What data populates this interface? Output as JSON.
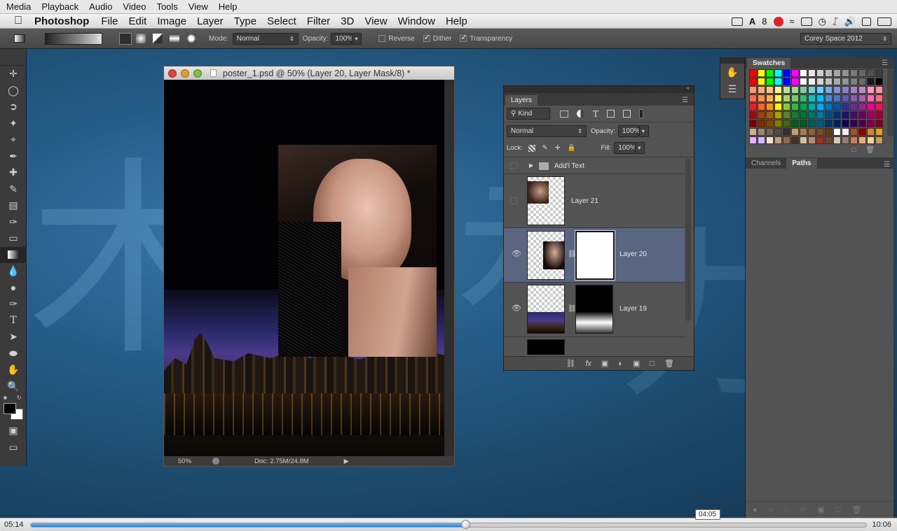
{
  "player_menu": {
    "items": [
      "Media",
      "Playback",
      "Audio",
      "Video",
      "Tools",
      "View",
      "Help"
    ]
  },
  "mac_menu": {
    "app_name": "Photoshop",
    "items": [
      "File",
      "Edit",
      "Image",
      "Layer",
      "Type",
      "Select",
      "Filter",
      "3D",
      "View",
      "Window",
      "Help"
    ],
    "tray_badge": "8",
    "clock": ""
  },
  "options_bar": {
    "mode_label": "Mode:",
    "mode_value": "Normal",
    "opacity_label": "Opacity:",
    "opacity_value": "100%",
    "reverse_label": "Reverse",
    "reverse_checked": false,
    "dither_label": "Dither",
    "dither_checked": true,
    "transparency_label": "Transparency",
    "transparency_checked": true,
    "workspace": "Corey Space 2012"
  },
  "document": {
    "title": "poster_1.psd @ 50% (Layer 20, Layer Mask/8) *",
    "zoom": "50%",
    "doc_info": "Doc: 2.75M/24.8M"
  },
  "layers_panel": {
    "tab": "Layers",
    "filter_kind": "Kind",
    "blend_mode": "Normal",
    "opacity_label": "Opacity:",
    "opacity_value": "100%",
    "lock_label": "Lock:",
    "fill_label": "Fill:",
    "fill_value": "100%",
    "layers": [
      {
        "name": "Add'l Text",
        "type": "group"
      },
      {
        "name": "Layer 21"
      },
      {
        "name": "Layer 20"
      },
      {
        "name": "Layer 19"
      }
    ]
  },
  "swatches_panel": {
    "tab": "Swatches"
  },
  "channels_panel": {
    "tabs": [
      "Channels",
      "Paths"
    ],
    "active": "Paths"
  },
  "timeline": {
    "current_time": "05:14",
    "hover_time": "04:05",
    "total_time": "10:06",
    "progress": 0.52
  },
  "colors": {
    "accent_progress": "#2f7fd0",
    "selected_layer": "#5a6582"
  }
}
